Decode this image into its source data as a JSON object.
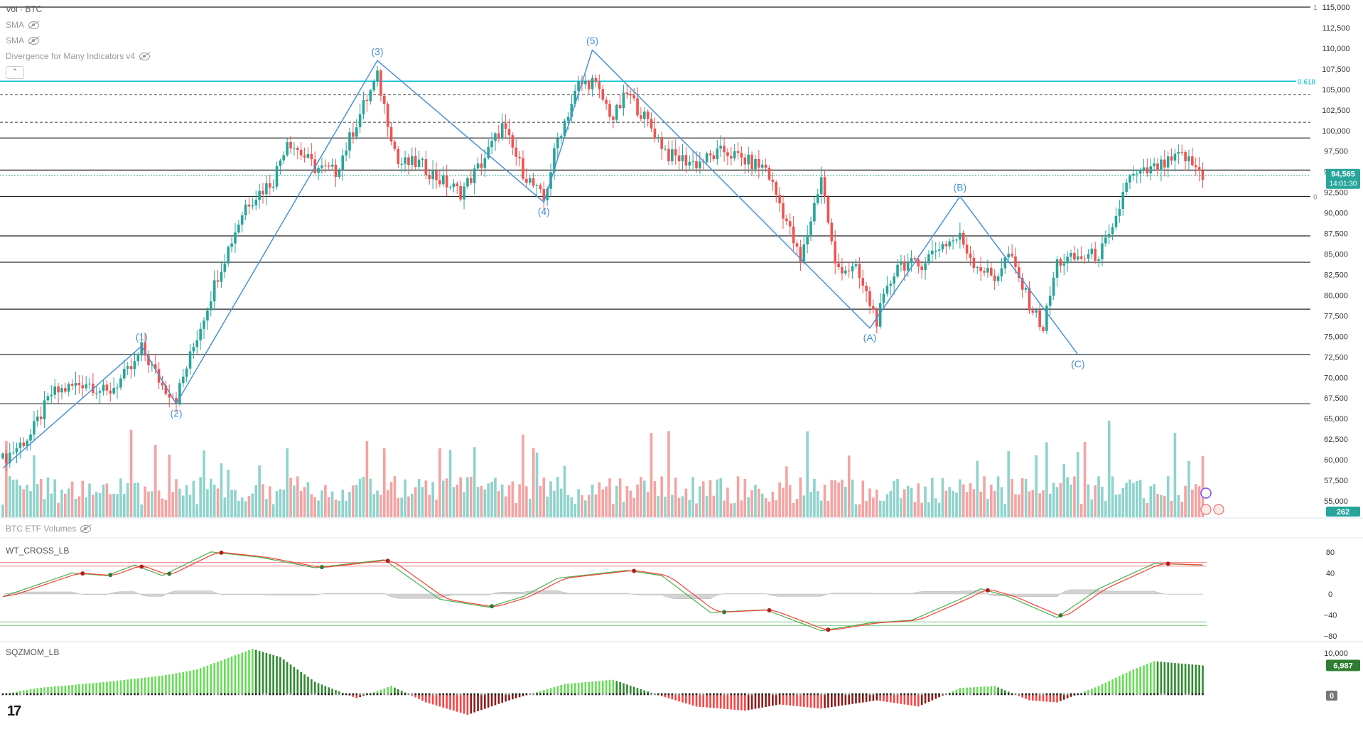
{
  "legends": {
    "vol": "Vol · BTC",
    "sma1": "SMA",
    "sma2": "SMA",
    "divergence": "Divergence for Many Indicators v4",
    "etf": "BTC ETF Volumes",
    "wt": "WT_CROSS_LB",
    "sqz": "SQZMOM_LB"
  },
  "collapse_glyph": "⌃",
  "logo_text": "17",
  "price_badge": {
    "price": "94,565",
    "countdown": "14:01:30",
    "volume": "262",
    "color": "#26a69a"
  },
  "sqz_badge": {
    "value": "6,987",
    "zero": "0"
  },
  "fib_label": "0.618",
  "line_labels": {
    "top": "1",
    "zero": "0"
  },
  "colors": {
    "up": "#26a69a",
    "down": "#ef5350",
    "wave": "#4a90d9",
    "fib": "#00bcd4",
    "wt_green": "#4caf50",
    "wt_red": "#f44336"
  },
  "chart_data": [
    {
      "type": "candlestick",
      "title": "BTC",
      "price_axis": [
        "115,000",
        "112,500",
        "110,000",
        "107,500",
        "105,000",
        "102,500",
        "100,000",
        "97,500",
        "95,000",
        "92,500",
        "90,000",
        "87,500",
        "85,000",
        "82,500",
        "80,000",
        "77,500",
        "75,000",
        "72,500",
        "70,000",
        "67,500",
        "65,000",
        "62,500",
        "60,000",
        "57,500",
        "55,000"
      ],
      "ylim": [
        52000,
        115800
      ],
      "last_price": 94565,
      "horizontal_levels": [
        115000,
        99100,
        95200,
        92000,
        87200,
        84000,
        78300,
        72800,
        66800
      ],
      "dashed_levels": [
        104350,
        101000
      ],
      "fib_618_level": 106000,
      "close_path_key": [
        [
          0,
          60000
        ],
        [
          8,
          63000
        ],
        [
          14,
          68000
        ],
        [
          24,
          69500
        ],
        [
          30,
          68000
        ],
        [
          38,
          71500
        ],
        [
          40,
          73500
        ],
        [
          46,
          69000
        ],
        [
          50,
          67500
        ],
        [
          56,
          75000
        ],
        [
          62,
          82500
        ],
        [
          70,
          91000
        ],
        [
          78,
          94000
        ],
        [
          82,
          99000
        ],
        [
          90,
          95500
        ],
        [
          96,
          95000
        ],
        [
          104,
          103000
        ],
        [
          108,
          106500
        ],
        [
          114,
          96000
        ],
        [
          120,
          96000
        ],
        [
          126,
          94000
        ],
        [
          132,
          92500
        ],
        [
          138,
          96000
        ],
        [
          144,
          100500
        ],
        [
          150,
          95000
        ],
        [
          156,
          91500
        ],
        [
          160,
          99000
        ],
        [
          166,
          105500
        ],
        [
          170,
          106000
        ],
        [
          176,
          101500
        ],
        [
          180,
          104500
        ],
        [
          186,
          101000
        ],
        [
          192,
          97000
        ],
        [
          200,
          96000
        ],
        [
          208,
          97500
        ],
        [
          216,
          96000
        ],
        [
          220,
          95500
        ],
        [
          226,
          89000
        ],
        [
          230,
          84000
        ],
        [
          236,
          94500
        ],
        [
          240,
          83500
        ],
        [
          246,
          83000
        ],
        [
          252,
          77000
        ],
        [
          258,
          84000
        ],
        [
          264,
          83500
        ],
        [
          270,
          86000
        ],
        [
          276,
          87000
        ],
        [
          280,
          84000
        ],
        [
          286,
          82000
        ],
        [
          290,
          85000
        ],
        [
          296,
          79000
        ],
        [
          300,
          76000
        ],
        [
          304,
          84000
        ],
        [
          310,
          84500
        ],
        [
          316,
          85000
        ],
        [
          320,
          87500
        ],
        [
          324,
          94000
        ],
        [
          330,
          95000
        ],
        [
          336,
          96000
        ],
        [
          340,
          97000
        ],
        [
          344,
          95500
        ],
        [
          346,
          94565
        ]
      ],
      "volume_series": "volume bars below candles (BTC Vol), higher on up days"
    },
    {
      "type": "line",
      "title": "WT_CROSS_LB",
      "y_axis": [
        "80",
        "40",
        "0",
        "−40",
        "−80"
      ],
      "ylim": [
        -90,
        90
      ],
      "ob_levels": [
        60,
        53
      ],
      "os_levels": [
        -53,
        -60
      ],
      "wt1_key": [
        [
          0,
          -5
        ],
        [
          20,
          40
        ],
        [
          30,
          35
        ],
        [
          38,
          55
        ],
        [
          46,
          35
        ],
        [
          60,
          80
        ],
        [
          74,
          70
        ],
        [
          90,
          50
        ],
        [
          110,
          65
        ],
        [
          126,
          -10
        ],
        [
          140,
          -25
        ],
        [
          150,
          -5
        ],
        [
          160,
          30
        ],
        [
          180,
          45
        ],
        [
          190,
          35
        ],
        [
          204,
          -35
        ],
        [
          220,
          -30
        ],
        [
          236,
          -70
        ],
        [
          250,
          -55
        ],
        [
          262,
          -50
        ],
        [
          276,
          -10
        ],
        [
          282,
          10
        ],
        [
          290,
          -5
        ],
        [
          304,
          -45
        ],
        [
          316,
          10
        ],
        [
          332,
          58
        ],
        [
          346,
          55
        ]
      ]
    },
    {
      "type": "bar",
      "title": "SQZMOM_LB",
      "y_axis": [
        "10,000"
      ],
      "last_value": 6987,
      "hist_key": [
        [
          0,
          0
        ],
        [
          10,
          1500
        ],
        [
          30,
          3000
        ],
        [
          46,
          4500
        ],
        [
          56,
          6000
        ],
        [
          64,
          8500
        ],
        [
          72,
          11000
        ],
        [
          80,
          9000
        ],
        [
          90,
          3000
        ],
        [
          102,
          -1000
        ],
        [
          112,
          2000
        ],
        [
          122,
          -2000
        ],
        [
          134,
          -5000
        ],
        [
          146,
          -1500
        ],
        [
          162,
          2500
        ],
        [
          176,
          3500
        ],
        [
          190,
          -500
        ],
        [
          200,
          -3000
        ],
        [
          214,
          -4000
        ],
        [
          224,
          -2500
        ],
        [
          236,
          -3500
        ],
        [
          252,
          -1500
        ],
        [
          264,
          -3000
        ],
        [
          276,
          1500
        ],
        [
          286,
          2000
        ],
        [
          296,
          -1500
        ],
        [
          304,
          -2000
        ],
        [
          316,
          2000
        ],
        [
          326,
          6000
        ],
        [
          332,
          8000
        ],
        [
          346,
          6987
        ]
      ]
    }
  ]
}
